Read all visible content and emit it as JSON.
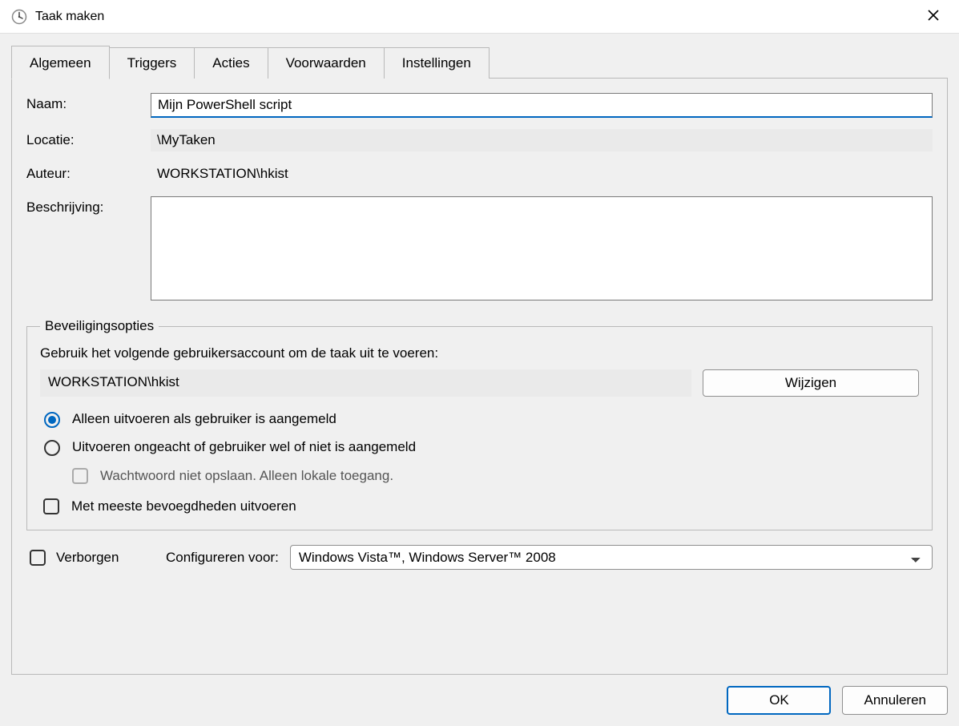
{
  "titlebar": {
    "title": "Taak maken",
    "close_aria": "Sluiten"
  },
  "tabs": [
    {
      "label": "Algemeen",
      "active": true
    },
    {
      "label": "Triggers",
      "active": false
    },
    {
      "label": "Acties",
      "active": false
    },
    {
      "label": "Voorwaarden",
      "active": false
    },
    {
      "label": "Instellingen",
      "active": false
    }
  ],
  "general": {
    "name_label": "Naam:",
    "name_value": "Mijn PowerShell script",
    "location_label": "Locatie:",
    "location_value": "\\MyTaken",
    "author_label": "Auteur:",
    "author_value": "WORKSTATION\\hkist",
    "description_label": "Beschrijving:",
    "description_value": ""
  },
  "security": {
    "groupbox_title": "Beveiligingsopties",
    "account_instruction": "Gebruik het volgende gebruikersaccount om de taak uit te voeren:",
    "account_value": "WORKSTATION\\hkist",
    "change_button": "Wijzigen",
    "radio_logged_on": "Alleen uitvoeren als gebruiker is aangemeld",
    "radio_any": "Uitvoeren ongeacht of gebruiker wel of niet is aangemeld",
    "checkbox_no_password": "Wachtwoord niet opslaan. Alleen lokale toegang.",
    "checkbox_highest_priv": "Met meeste bevoegdheden uitvoeren",
    "run_mode_selected": "logged_on"
  },
  "bottom": {
    "hidden_label": "Verborgen",
    "hidden_checked": false,
    "configure_for_label": "Configureren voor:",
    "configure_for_value": "Windows Vista™, Windows Server™ 2008"
  },
  "footer": {
    "ok_label": "OK",
    "cancel_label": "Annuleren"
  }
}
